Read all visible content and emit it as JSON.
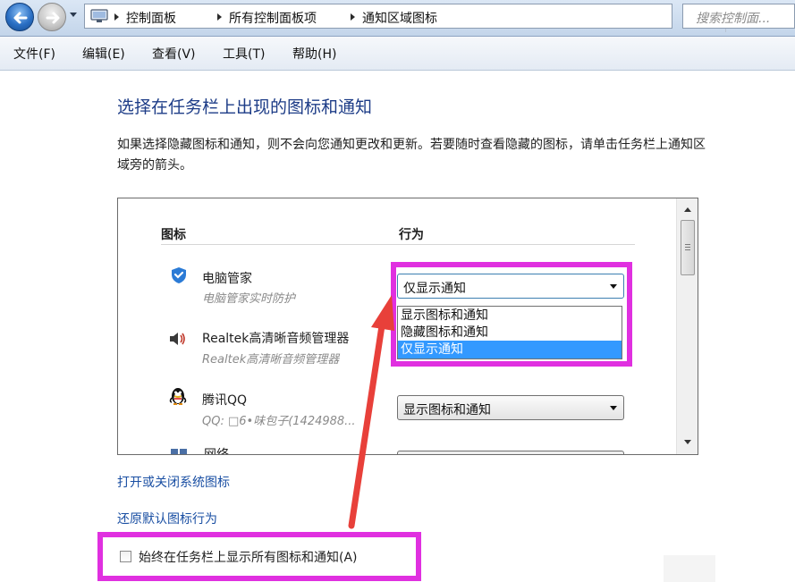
{
  "address_bar": {
    "breadcrumbs": [
      "控制面板",
      "所有控制面板项",
      "通知区域图标"
    ],
    "search_placeholder": "搜索控制面..."
  },
  "menu": {
    "items": [
      "文件(F)",
      "编辑(E)",
      "查看(V)",
      "工具(T)",
      "帮助(H)"
    ]
  },
  "content": {
    "title": "选择在任务栏上出现的图标和通知",
    "description": "如果选择隐藏图标和通知，则不会向您通知更改和更新。若要随时查看隐藏的图标，请单击任务栏上通知区域旁的箭头。",
    "table": {
      "col_icon": "图标",
      "col_behavior": "行为",
      "rows": [
        {
          "name": "电脑管家",
          "sub": "电脑管家实时防护",
          "behavior": "仅显示通知",
          "icon": "shield-icon"
        },
        {
          "name": "Realtek高清晰音频管理器",
          "sub": "Realtek高清晰音频管理器",
          "behavior": "",
          "icon": "speaker-icon"
        },
        {
          "name": "腾讯QQ",
          "sub": "QQ: □6•味包子(1424988...",
          "behavior": "显示图标和通知",
          "icon": "qq-penguin-icon"
        },
        {
          "name": "网络",
          "sub": "",
          "behavior": "",
          "icon": "network-icon"
        }
      ],
      "dropdown_options": [
        "显示图标和通知",
        "隐藏图标和通知",
        "仅显示通知"
      ],
      "dropdown_selected": "仅显示通知"
    },
    "links": {
      "system_icons": "打开或关闭系统图标",
      "restore_default": "还原默认图标行为"
    },
    "checkbox": {
      "label": "始终在任务栏上显示所有图标和通知(A)",
      "checked": false
    }
  },
  "colors": {
    "title_blue": "#1d3c87",
    "link_blue": "#1a4fa3",
    "highlight_magenta": "#e030e0",
    "arrow_red": "#e8403a",
    "selection_blue": "#3399ff"
  }
}
